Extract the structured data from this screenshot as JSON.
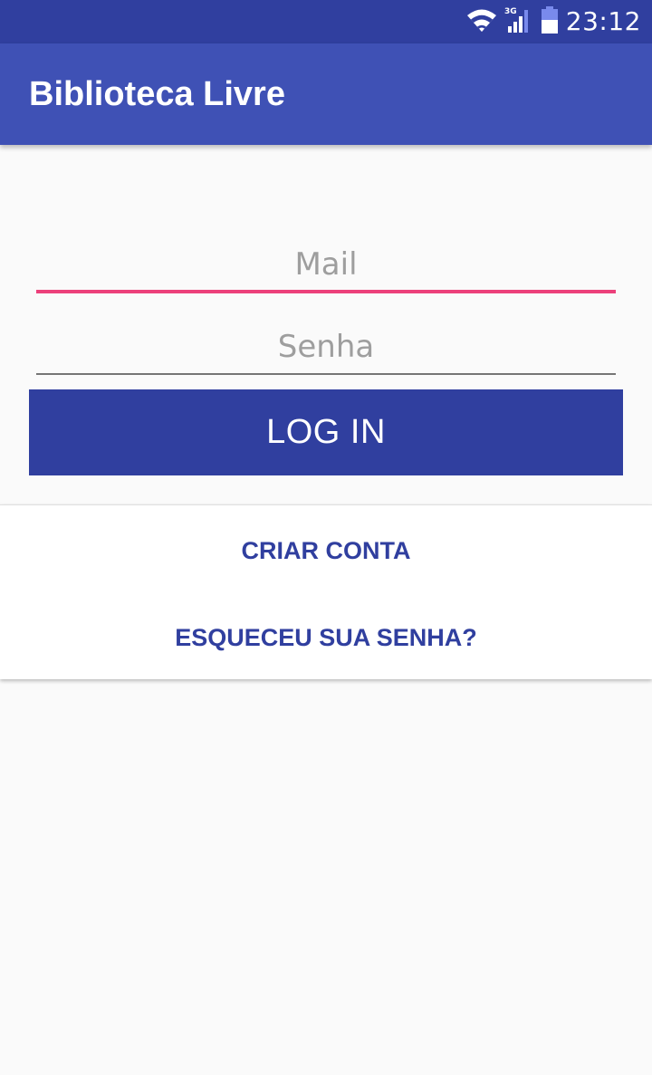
{
  "status_bar": {
    "time": "23:12",
    "network_label": "3G",
    "icons": [
      "wifi-icon",
      "cellular-signal-icon",
      "battery-icon"
    ],
    "color": "#303F9F"
  },
  "app_bar": {
    "title": "Biblioteca Livre",
    "color": "#3F51B5"
  },
  "form": {
    "mail_placeholder": "Mail",
    "mail_value": "",
    "senha_placeholder": "Senha",
    "senha_value": "",
    "login_label": "LOG IN",
    "focus_color": "#EC407A"
  },
  "actions": {
    "criar_conta_label": "CRIAR CONTA",
    "esqueceu_senha_label": "ESQUECEU SUA SENHA?"
  }
}
